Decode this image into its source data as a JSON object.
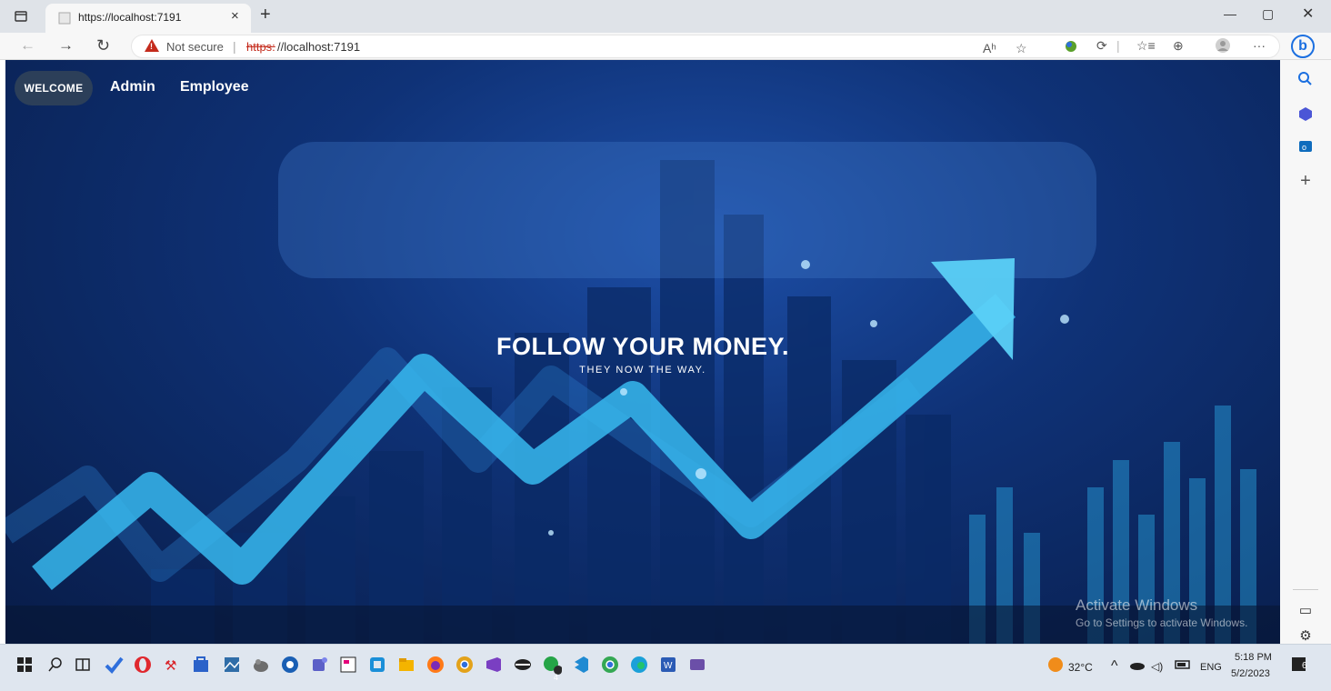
{
  "browser": {
    "tab_title": "https://localhost:7191",
    "tab_close": "×",
    "new_tab": "+",
    "window": {
      "minimize": "—",
      "restore": "▢",
      "close": "✕"
    },
    "nav": {
      "back": "←",
      "forward": "→",
      "reload": "↻"
    },
    "address": {
      "security_label": "Not secure",
      "separator": "|",
      "url_scheme": "https:",
      "url_rest": "//localhost:7191"
    },
    "toolbar_icons": [
      "read-aloud-icon",
      "add-favorite-icon",
      "extension-icon",
      "browser-essentials-icon",
      "favorites-icon",
      "collections-icon",
      "profile-icon",
      "more-icon"
    ],
    "toolbar_glyphs": {
      "read_aloud": "Aʰ",
      "add_favorite": "☆",
      "browser_essentials": "⟳",
      "favorites": "☆≡",
      "collections": "⊕",
      "more": "···"
    },
    "bing_label": "b"
  },
  "sidebar": {
    "icons": [
      "search-icon",
      "office-icon",
      "outlook-icon",
      "add-icon",
      "split-screen-icon",
      "settings-icon"
    ],
    "add_glyph": "+",
    "split_glyph": "▭",
    "settings_glyph": "⚙"
  },
  "page": {
    "nav": {
      "welcome": "WELCOME",
      "admin": "Admin",
      "employee": "Employee"
    },
    "hero": {
      "title": "FOLLOW YOUR MONEY.",
      "subtitle": "THEY NOW THE WAY."
    },
    "watermark": {
      "title": "Activate Windows",
      "subtitle": "Go to Settings to activate Windows."
    }
  },
  "taskbar": {
    "apps": [
      "windows-start-icon",
      "search-icon",
      "task-view-icon",
      "todo-icon",
      "opera-icon",
      "autocad-icon",
      "store-icon",
      "photos-icon",
      "gimp-icon",
      "edge-icon",
      "teams-icon",
      "jetbrains-icon",
      "remote-icon",
      "file-explorer-icon",
      "firefox-icon",
      "chrome-icon",
      "visual-studio-icon",
      "app-icon",
      "whatsapp-icon",
      "vscode-icon",
      "chrome-icon-2",
      "edge-active-icon",
      "word-icon",
      "app-icon-2"
    ],
    "whatsapp_badge": "4",
    "weather": "32°C",
    "lang": "ENG",
    "time": "5:18 PM",
    "date": "5/2/2023",
    "notifications": "6",
    "colors": {
      "todo": "#2f6fdc",
      "opera": "#e0282e",
      "store": "#2b62c9",
      "edge": "#1aa0d8",
      "firefox": "#ff7a18",
      "chrome": "#e3a21a",
      "vs": "#7a3fc2",
      "whatsapp": "#25a447",
      "vscode": "#1f8ad2",
      "word": "#2b5bb5"
    }
  }
}
